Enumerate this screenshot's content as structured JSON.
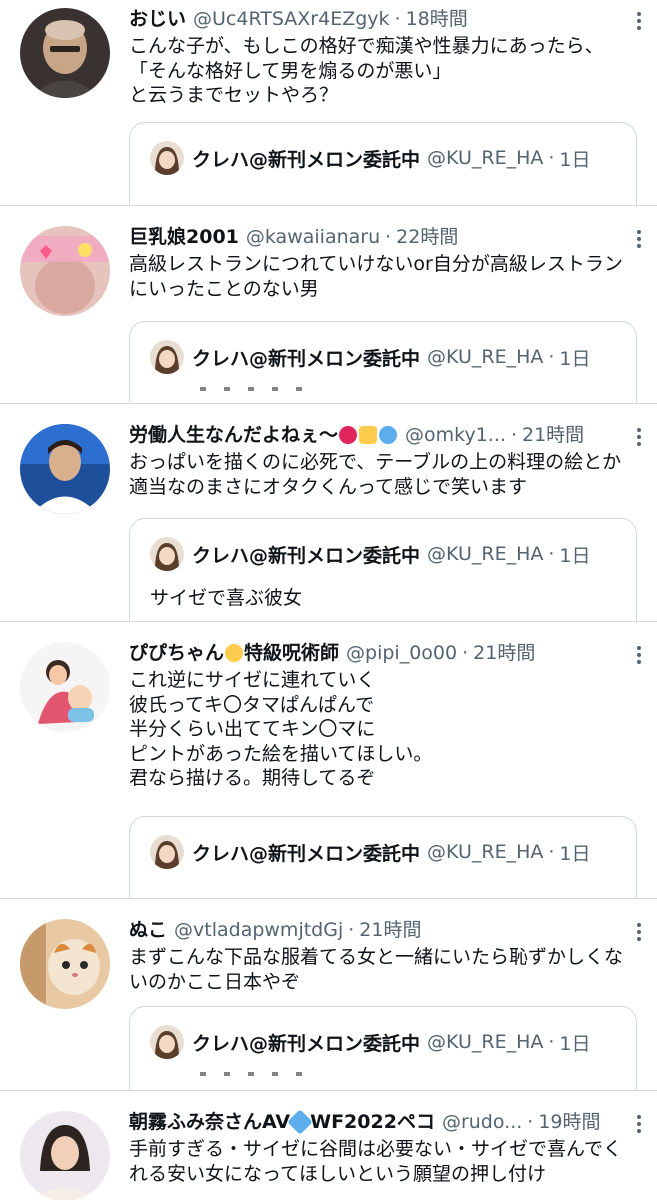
{
  "tweets": [
    {
      "name": "おじい",
      "handle": "@Uc4RTSAXr4EZgyk",
      "time": "18時間",
      "text": "こんな子が、もしこの格好で痴漢や性暴力にあったら、\n「そんな格好して男を煽るのが悪い」\nと云うまでセットやろ？",
      "quote": {
        "name": "クレハ@新刊メロン委託中",
        "handle": "@KU_RE_HA",
        "time": "1日",
        "text": ""
      }
    },
    {
      "name": "巨乳娘2001",
      "handle": "@kawaiianaru",
      "time": "22時間",
      "text": "高級レストランにつれていけないor自分が高級レストランにいったことのない男",
      "quote": {
        "name": "クレハ@新刊メロン委託中",
        "handle": "@KU_RE_HA",
        "time": "1日",
        "text": ""
      }
    },
    {
      "name": "労働人生なんだよねぇ〜",
      "handle": "@omky1...",
      "time": "21時間",
      "text": "おっぱいを描くのに必死で、テーブルの上の料理の絵とか適当なのまさにオタクくんって感じで笑います",
      "quote": {
        "name": "クレハ@新刊メロン委託中",
        "handle": "@KU_RE_HA",
        "time": "1日",
        "text": "サイゼで喜ぶ彼女"
      }
    },
    {
      "name": "ぴぴちゃん",
      "name_suffix": "特級呪術師",
      "handle": "@pipi_0o00",
      "time": "21時間",
      "text": "これ逆にサイゼに連れていく\n彼氏ってキ〇タマぱんぱんで\n半分くらい出ててキン〇マに\nピントがあった絵を描いてほしい。\n君なら描ける。期待してるぞ",
      "quote": {
        "name": "クレハ@新刊メロン委託中",
        "handle": "@KU_RE_HA",
        "time": "1日",
        "text": ""
      }
    },
    {
      "name": "ぬこ",
      "handle": "@vtladapwmjtdGj",
      "time": "21時間",
      "text": "まずこんな下品な服着てる女と一緒にいたら恥ずかしくないのかここ日本やぞ",
      "quote": {
        "name": "クレハ@新刊メロン委託中",
        "handle": "@KU_RE_HA",
        "time": "1日",
        "text": ""
      }
    },
    {
      "name": "朝霧ふみ奈さんAV",
      "name_suffix": "WF2022ペコ",
      "handle": "@rudo...",
      "time": "19時間",
      "text": "手前すぎる・サイゼに谷間は必要ない・サイゼで喜んでくれる安い女になってほしいという願望の押し付け",
      "quote": null
    }
  ],
  "colors": {
    "text_primary": "#0f1419",
    "text_secondary": "#536471",
    "divider": "#d6dbe0",
    "quote_border": "#cfd9de"
  },
  "icons": {
    "more": "more-vertical-icon",
    "angry_emoji": "angry-face-emoji",
    "hand_emoji": "raised-hand-emoji",
    "sweat_emoji": "sweat-droplets-emoji",
    "chick_emoji": "hatching-chick-emoji",
    "diamond_emoji": "gem-emoji"
  }
}
